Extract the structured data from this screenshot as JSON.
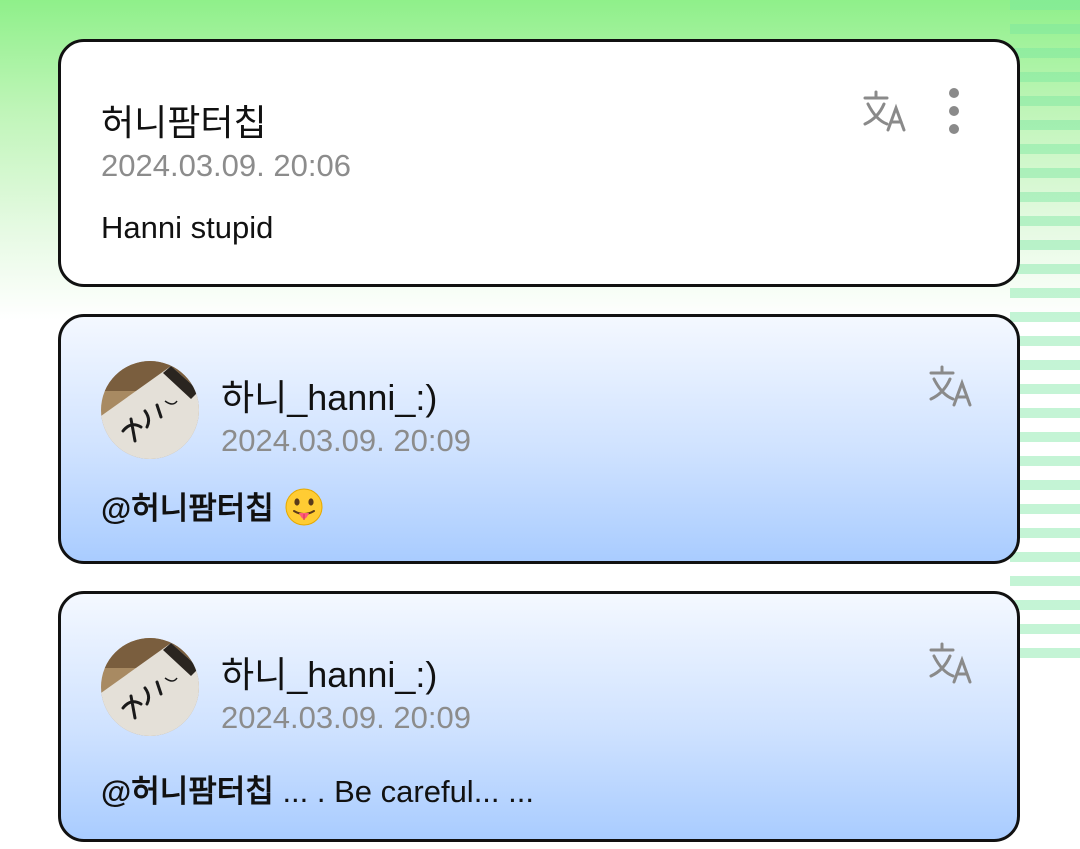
{
  "comments": [
    {
      "author": "허니팜터칩",
      "timestamp": "2024.03.09. 20:06",
      "text": "Hanni stupid",
      "icons": [
        "translate-icon",
        "more-vertical-icon"
      ]
    },
    {
      "author": "하니_hanni_:)",
      "timestamp": "2024.03.09. 20:09",
      "mention": "@허니팜터칩",
      "text": "",
      "emoji": "tongue-out-face",
      "icons": [
        "translate-icon"
      ]
    },
    {
      "author": "하니_hanni_:)",
      "timestamp": "2024.03.09. 20:09",
      "mention": "@허니팜터칩",
      "text": " ... . Be careful... ...",
      "icons": [
        "translate-icon"
      ]
    }
  ],
  "colors": {
    "background_top": "#8ff08a",
    "reply_card_top": "#f4f8ff",
    "reply_card_bottom": "#a9ccff",
    "timestamp": "#8c8c8c",
    "border": "#111111"
  }
}
